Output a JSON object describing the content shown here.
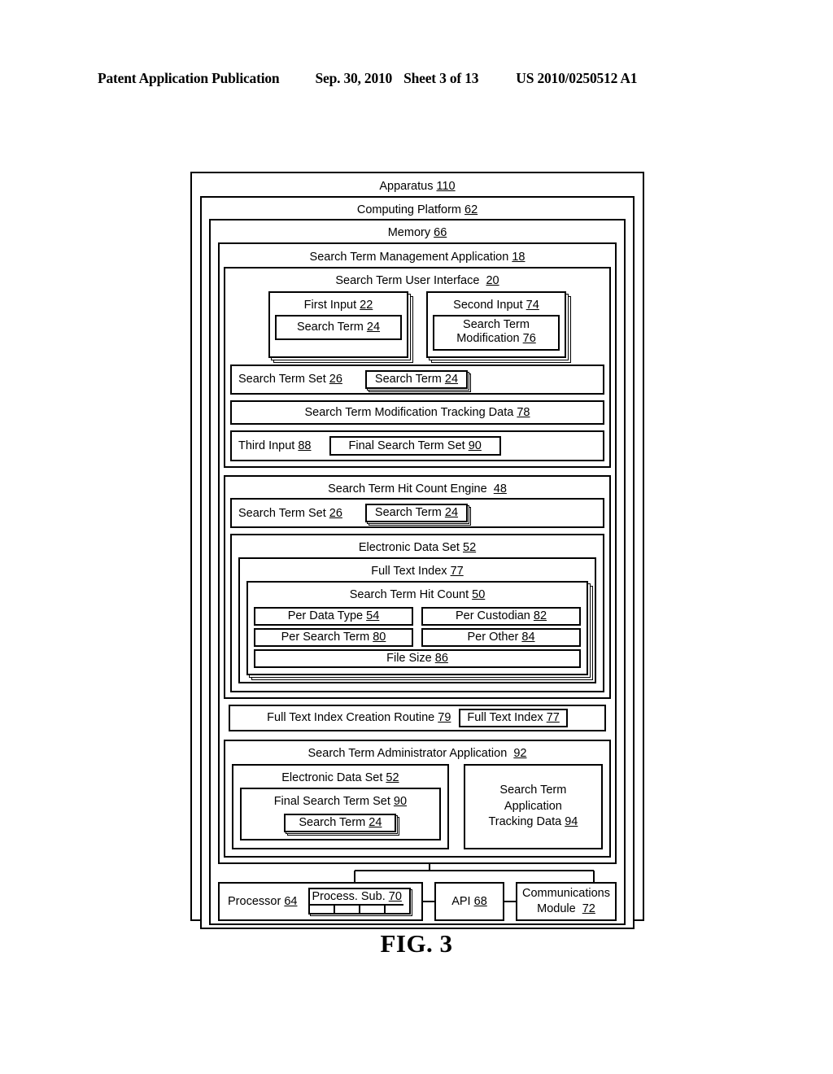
{
  "header": {
    "publication": "Patent Application Publication",
    "date": "Sep. 30, 2010",
    "sheet": "Sheet 3 of 13",
    "number": "US 2010/0250512 A1"
  },
  "figure": {
    "caption": "FIG. 3"
  },
  "diagram": {
    "apparatus": {
      "label": "Apparatus",
      "ref": "110"
    },
    "platform": {
      "label": "Computing Platform",
      "ref": "62"
    },
    "memory": {
      "label": "Memory",
      "ref": "66"
    },
    "management_application": {
      "label": "Search Term Management Application",
      "ref": "18"
    },
    "user_interface": {
      "label": "Search Term User Interface",
      "ref": "20",
      "first_input": {
        "label": "First Input",
        "ref": "22",
        "inner": "Search Term",
        "inner_ref": "24"
      },
      "second_input": {
        "label": "Second Input",
        "ref": "74",
        "inner_line1": "Search Term",
        "inner_line2": "Modification",
        "inner_ref": "76"
      },
      "search_term_set": {
        "label": "Search Term Set",
        "ref": "26",
        "term": "Search Term",
        "term_ref": "24"
      },
      "tracking_data": {
        "label": "Search Term Modification Tracking Data",
        "ref": "78"
      },
      "third_input": {
        "label": "Third Input",
        "ref": "88",
        "final_set": "Final Search Term Set",
        "final_set_ref": "90"
      }
    },
    "hit_count_engine": {
      "label": "Search Term Hit Count Engine",
      "ref": "48",
      "search_term_set": {
        "label": "Search Term Set",
        "ref": "26",
        "term": "Search Term",
        "term_ref": "24"
      },
      "electronic_data_set": {
        "label": "Electronic Data Set",
        "ref": "52"
      },
      "full_text_index": {
        "label": "Full Text Index",
        "ref": "77"
      },
      "hit_count": {
        "label": "Search Term Hit Count",
        "ref": "50",
        "cells": [
          {
            "label": "Per Data Type",
            "ref": "54"
          },
          {
            "label": "Per Custodian",
            "ref": "82"
          },
          {
            "label": "Per Search Term",
            "ref": "80"
          },
          {
            "label": "Per Other",
            "ref": "84"
          }
        ],
        "file_size": {
          "label": "File Size",
          "ref": "86"
        }
      },
      "index_creation": {
        "label": "Full Text Index Creation Routine",
        "ref": "79",
        "boxed": "Full Text Index",
        "boxed_ref": "77"
      }
    },
    "administrator_application": {
      "label": "Search Term Administrator Application",
      "ref": "92",
      "electronic_data_set": {
        "label": "Electronic Data Set",
        "ref": "52"
      },
      "final_search_term_set": {
        "label": "Final Search Term Set",
        "ref": "90",
        "term": "Search Term",
        "term_ref": "24"
      },
      "tracking_data": {
        "line1": "Search Term",
        "line2": "Application",
        "line3": "Tracking Data",
        "ref": "94"
      }
    },
    "hardware": {
      "processor": {
        "label": "Processor",
        "ref": "64"
      },
      "process_subsystem": {
        "label": "Process. Sub.",
        "ref": "70"
      },
      "api": {
        "label": "API",
        "ref": "68"
      },
      "communications_module": {
        "line1": "Communications",
        "line2": "Module",
        "ref": "72"
      }
    }
  }
}
